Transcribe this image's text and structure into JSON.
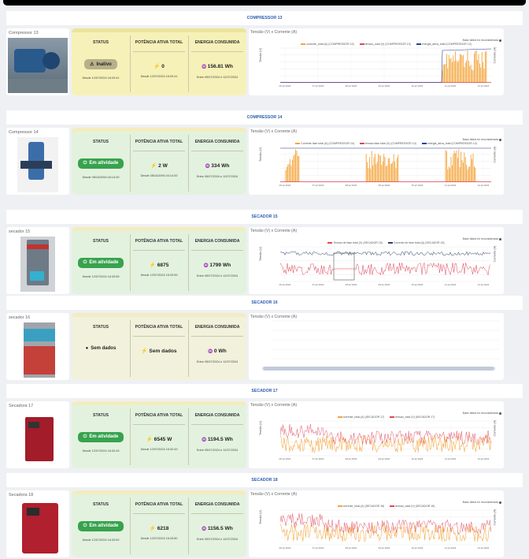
{
  "sections": [
    {
      "title": "COMPRESSOR 13",
      "name": "Compressor 13",
      "status": "Inativo",
      "status_kind": "inactive",
      "since": "Desde 12/07/2024 16:03:41",
      "power": "0",
      "power_since": "Desde 12/07/2024 16:03:41",
      "energy": "156.81 Wh",
      "energy_period": "Entre 05/07/2024 e 12/07/2024",
      "chart_title": "Tensão (V) x Corrente (A)",
      "chart_note": "Base diária foi reconsiderada",
      "legend": [
        {
          "label": "corrente_total (A) (COMPRESSOR 13)",
          "color": "#f4a53b"
        },
        {
          "label": "tensao_total (V) (COMPRESSOR 13)",
          "color": "#e0455a"
        },
        {
          "label": "energia_ativa_total (COMPRESSOR 13)",
          "color": "#2d3f9a"
        }
      ],
      "ylabel_left": "Tensão (V)",
      "ylabel_right": "Corrente (A)",
      "chart_kind": "c13",
      "theme": "yellow"
    },
    {
      "title": "COMPRESSOR 14",
      "name": "Compressor 14",
      "status": "Em atividade",
      "status_kind": "active",
      "since": "Desde 08/10/2094 04:14:00",
      "power": "2 W",
      "power_since": "Desde 08/10/2094 04:14:00",
      "energy": "334 Wh",
      "energy_period": "Entre 05/07/2024 e 12/07/2024",
      "chart_title": "Tensão (V) x Corrente (A)",
      "chart_note": "Base diária foi reconsiderada",
      "legend": [
        {
          "label": "Corrente fase total (A) (COMPRESSOR 14)",
          "color": "#f4a53b"
        },
        {
          "label": "tensao fase total (V) (COMPRESSOR 14)",
          "color": "#e0455a"
        },
        {
          "label": "energia_ativa_total (COMPRESSOR 14)",
          "color": "#2d3f9a"
        }
      ],
      "ylabel_left": "Tensão (V)",
      "ylabel_right": "Corrente (A)",
      "chart_kind": "c14",
      "theme": "green"
    },
    {
      "title": "SECADOR 15",
      "name": "secador 15",
      "status": "Em atividade",
      "status_kind": "active",
      "since": "Desde 12/07/2024 16:33:59",
      "power": "6875",
      "power_since": "Desde 12/07/2024 16:33:59",
      "energy": "1799 Wh",
      "energy_period": "Entre 05/07/2024 e 12/07/2024",
      "chart_title": "Tensão (V) x Corrente (A)",
      "chart_note": "Base diária foi reconsiderada",
      "legend": [
        {
          "label": "Tensao de fase total (V) (SECADOR 15)",
          "color": "#e0455a"
        },
        {
          "label": "Corrente de fase total (A) (SECADOR 15)",
          "color": "#2d3f6a"
        }
      ],
      "ylabel_left": "Tensão (V)",
      "ylabel_right": "Corrente (A)",
      "chart_kind": "s15",
      "theme": "green"
    },
    {
      "title": "SECADOR 16",
      "name": "secador 16",
      "status": "Sem dados",
      "status_kind": "nodata",
      "since": "",
      "power": "Sem dados",
      "power_since": "",
      "energy": "0 Wh",
      "energy_period": "Entre 05/07/2024 e 12/07/2024",
      "chart_title": "Tensão (V) x Corrente (A)",
      "chart_note": "",
      "legend": [],
      "ylabel_left": "",
      "ylabel_right": "",
      "chart_kind": "empty",
      "theme": "beige"
    },
    {
      "title": "SECADOR 17",
      "name": "Secadora 17",
      "status": "Em atividade",
      "status_kind": "active",
      "since": "Desde 12/07/2024 16:32:43",
      "power": "6545 W",
      "power_since": "Desde 12/07/2024 16:32:43",
      "energy": "1194.5 Wh",
      "energy_period": "Entre 05/07/2024 e 12/07/2024",
      "chart_title": "Tensão (V) x Corrente (A)",
      "chart_note": "Base diária foi reconsiderada",
      "legend": [
        {
          "label": "corrente_total (A) (SECADOR 17)",
          "color": "#f4a53b"
        },
        {
          "label": "tensao_total (V) (SECADOR 17)",
          "color": "#e0455a"
        }
      ],
      "ylabel_left": "Tensão (V)",
      "ylabel_right": "Corrente (A)",
      "chart_kind": "s17",
      "theme": "green"
    },
    {
      "title": "SECADOR 18",
      "name": "Secadora 18",
      "status": "Em atividade",
      "status_kind": "active",
      "since": "Desde 12/07/2024 16:33:50",
      "power": "6218",
      "power_since": "Desde 12/07/2024 16:33:50",
      "energy": "1156.5 Wh",
      "energy_period": "Entre 05/07/2024 e 12/07/2024",
      "chart_title": "Tensão (V) x Corrente (A)",
      "chart_note": "Base diária foi reconsiderada",
      "legend": [
        {
          "label": "corrente_total (A) (SECADOR 18)",
          "color": "#f4a53b"
        },
        {
          "label": "tensao_total (V) (SECADOR 18)",
          "color": "#e0455a"
        }
      ],
      "ylabel_left": "Tensão (V)",
      "ylabel_right": "Corrente (A)",
      "chart_kind": "s18",
      "theme": "green"
    }
  ],
  "labels": {
    "status": "STATUS",
    "power": "POTÊNCIA ATIVA TOTAL",
    "energy": "ENERGIA CONSUMIDA"
  },
  "x_ticks": [
    "06 jul 2024",
    "07 jul 2024",
    "08 jul 2024",
    "09 jul 2024",
    "10 jul 2024",
    "11 jul 2024",
    "12 jul 2024"
  ],
  "colors": {
    "yellow_bg": "#f6f1b8",
    "yellow_bar": "#ece59a",
    "green_bg": "#e3f2de",
    "green_bar": "#f3ecbf",
    "beige_bg": "#f1f1dc",
    "beige_bar": "#f2ecc4",
    "accent": "#2a5db0"
  },
  "icons": {
    "inactive": "warning-icon",
    "active": "power-icon",
    "nodata": "circle-dot-icon",
    "power": "bolt-icon",
    "energy": "energy-icon"
  }
}
